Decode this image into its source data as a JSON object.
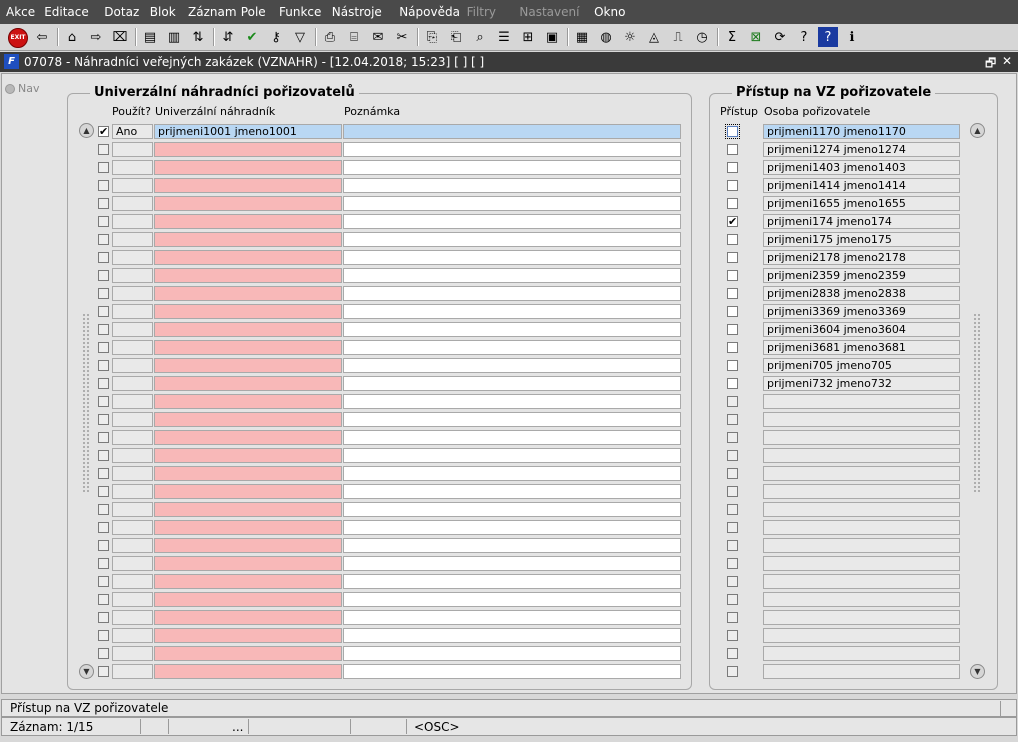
{
  "menu": [
    "Akce",
    "Editace",
    "Dotaz",
    "Blok",
    "Záznam",
    "Pole",
    "Funkce",
    "Nástroje",
    "Nápověda",
    "Filtry",
    "Nastavení",
    "Okno"
  ],
  "menu_disabled": [
    "Filtry",
    "Nastavení"
  ],
  "toolbar_icons": [
    "exit-icon",
    "bookmark-back-icon",
    "enter-query-icon",
    "execute-query-icon",
    "clear-record-icon",
    "insert-record-icon",
    "delete-record-icon",
    "sort-asc-icon",
    "sort-desc-icon",
    "save-checkmark-icon",
    "key-icon",
    "filter-icon",
    "print-icon",
    "print-preview-icon",
    "mail-icon",
    "cut-icon",
    "copy-icon",
    "paste-icon",
    "find-icon",
    "list-icon",
    "tree-icon",
    "clipboard-icon",
    "form-icon",
    "globe-icon",
    "sun-icon",
    "eye-icon",
    "chart-icon",
    "clock-icon",
    "sum-icon",
    "excel-icon",
    "refresh-icon",
    "help-query-icon",
    "help-icon",
    "info-icon"
  ],
  "window": {
    "title": "07078 - Náhradníci veřejných zakázek (VZNAHR) - [12.04.2018; 15:23]  [ ]  [ ]",
    "restore_glyph": "🗗",
    "close_glyph": "✕"
  },
  "nav_label": "Nav",
  "left_panel": {
    "title": "Univerzální náhradníci pořizovatelů",
    "col_pouzit": "Použít?",
    "col_nahradnik": "Univerzální náhradník",
    "col_poznamka": "Poznámka",
    "rows": [
      {
        "checked": true,
        "pouzit": "Ano",
        "nahradnik": "prijmeni1001 jmeno1001",
        "poznamka": ""
      }
    ],
    "empty_rows": 30
  },
  "right_panel": {
    "title": "Přístup na VZ pořizovatele",
    "col_pristup": "Přístup",
    "col_osoba": "Osoba pořizovatele",
    "rows": [
      {
        "checked": false,
        "osoba": "prijmeni1170 jmeno1170"
      },
      {
        "checked": false,
        "osoba": "prijmeni1274 jmeno1274"
      },
      {
        "checked": false,
        "osoba": "prijmeni1403 jmeno1403"
      },
      {
        "checked": false,
        "osoba": "prijmeni1414 jmeno1414"
      },
      {
        "checked": false,
        "osoba": "prijmeni1655 jmeno1655"
      },
      {
        "checked": true,
        "osoba": "prijmeni174 jmeno174"
      },
      {
        "checked": false,
        "osoba": "prijmeni175 jmeno175"
      },
      {
        "checked": false,
        "osoba": "prijmeni2178 jmeno2178"
      },
      {
        "checked": false,
        "osoba": "prijmeni2359 jmeno2359"
      },
      {
        "checked": false,
        "osoba": "prijmeni2838 jmeno2838"
      },
      {
        "checked": false,
        "osoba": "prijmeni3369 jmeno3369"
      },
      {
        "checked": false,
        "osoba": "prijmeni3604 jmeno3604"
      },
      {
        "checked": false,
        "osoba": "prijmeni3681 jmeno3681"
      },
      {
        "checked": false,
        "osoba": "prijmeni705 jmeno705"
      },
      {
        "checked": false,
        "osoba": "prijmeni732 jmeno732"
      }
    ],
    "empty_rows": 16
  },
  "status": {
    "hint": "Přístup na VZ pořizovatele",
    "record": "Záznam: 1/15",
    "dots": "...",
    "mode": "<OSC>"
  },
  "colors": {
    "menubar": "#4a4a4a",
    "required_field": "#f8b8b8",
    "selected_field": "#b9d7f3"
  }
}
